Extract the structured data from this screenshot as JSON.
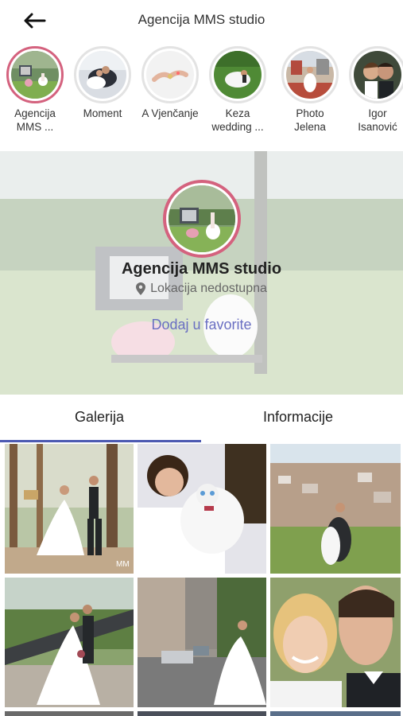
{
  "header": {
    "title": "Agencija MMS studio"
  },
  "stories": [
    {
      "label_line1": "Agencija",
      "label_line2": "MMS ..."
    },
    {
      "label_line1": "Moment",
      "label_line2": ""
    },
    {
      "label_line1": "A Vjenčanje",
      "label_line2": ""
    },
    {
      "label_line1": "Keza",
      "label_line2": "wedding ..."
    },
    {
      "label_line1": "Photo",
      "label_line2": "Jelena"
    },
    {
      "label_line1": "Igor",
      "label_line2": "Isanović"
    }
  ],
  "profile": {
    "name": "Agencija MMS studio",
    "location": "Lokacija nedostupna",
    "favorite_link": "Dodaj u favorite"
  },
  "tabs": {
    "gallery": "Galerija",
    "info": "Informacije",
    "selected": "gallery"
  },
  "colors": {
    "accent_ring": "#d4627e",
    "link": "#6a6fc2",
    "tab_indicator": "#4d5ab2"
  },
  "watermark": {
    "photo1": "MM"
  }
}
